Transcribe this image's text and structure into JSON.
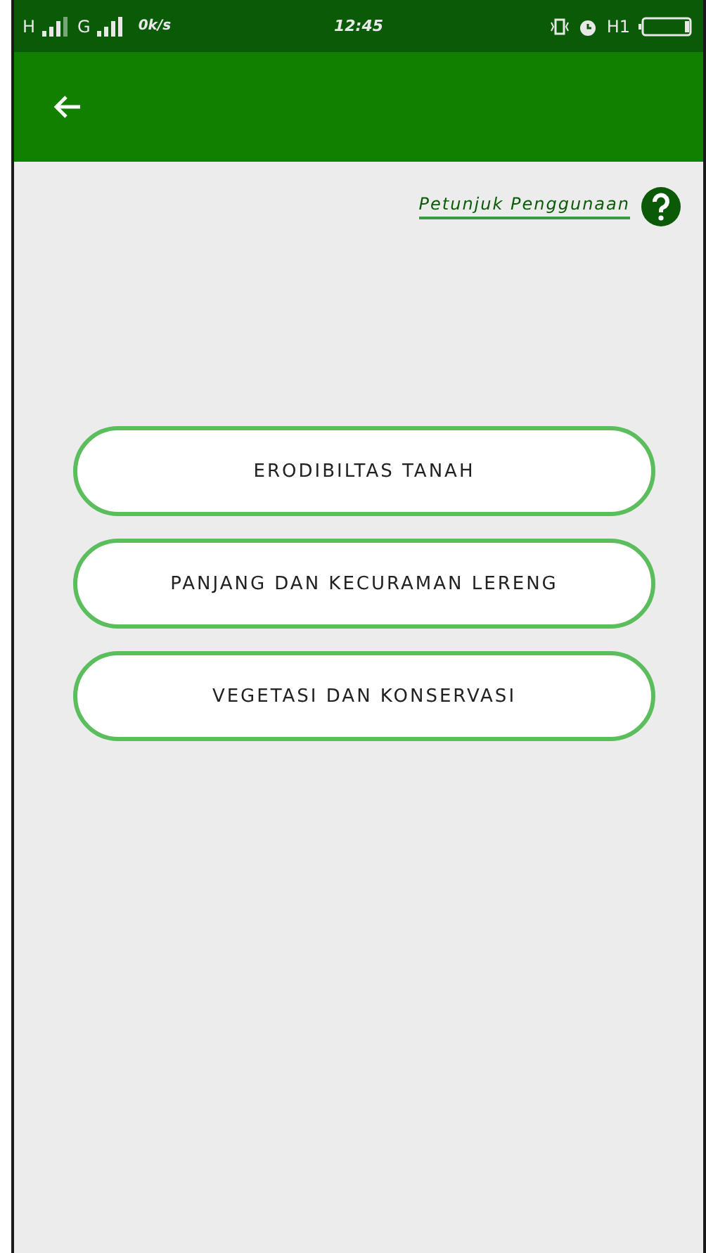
{
  "status_bar": {
    "network_1": "H",
    "network_2": "G",
    "speed": "0k/s",
    "time": "12:45",
    "data_label": "H1"
  },
  "app_bar": {
    "back": true
  },
  "help_link": {
    "label": "Petunjuk Penggunaan"
  },
  "menu": [
    {
      "label": "ERODIBILTAS TANAH"
    },
    {
      "label": "PANJANG DAN KECURAMAN LERENG"
    },
    {
      "label": "VEGETASI DAN KONSERVASI"
    }
  ]
}
